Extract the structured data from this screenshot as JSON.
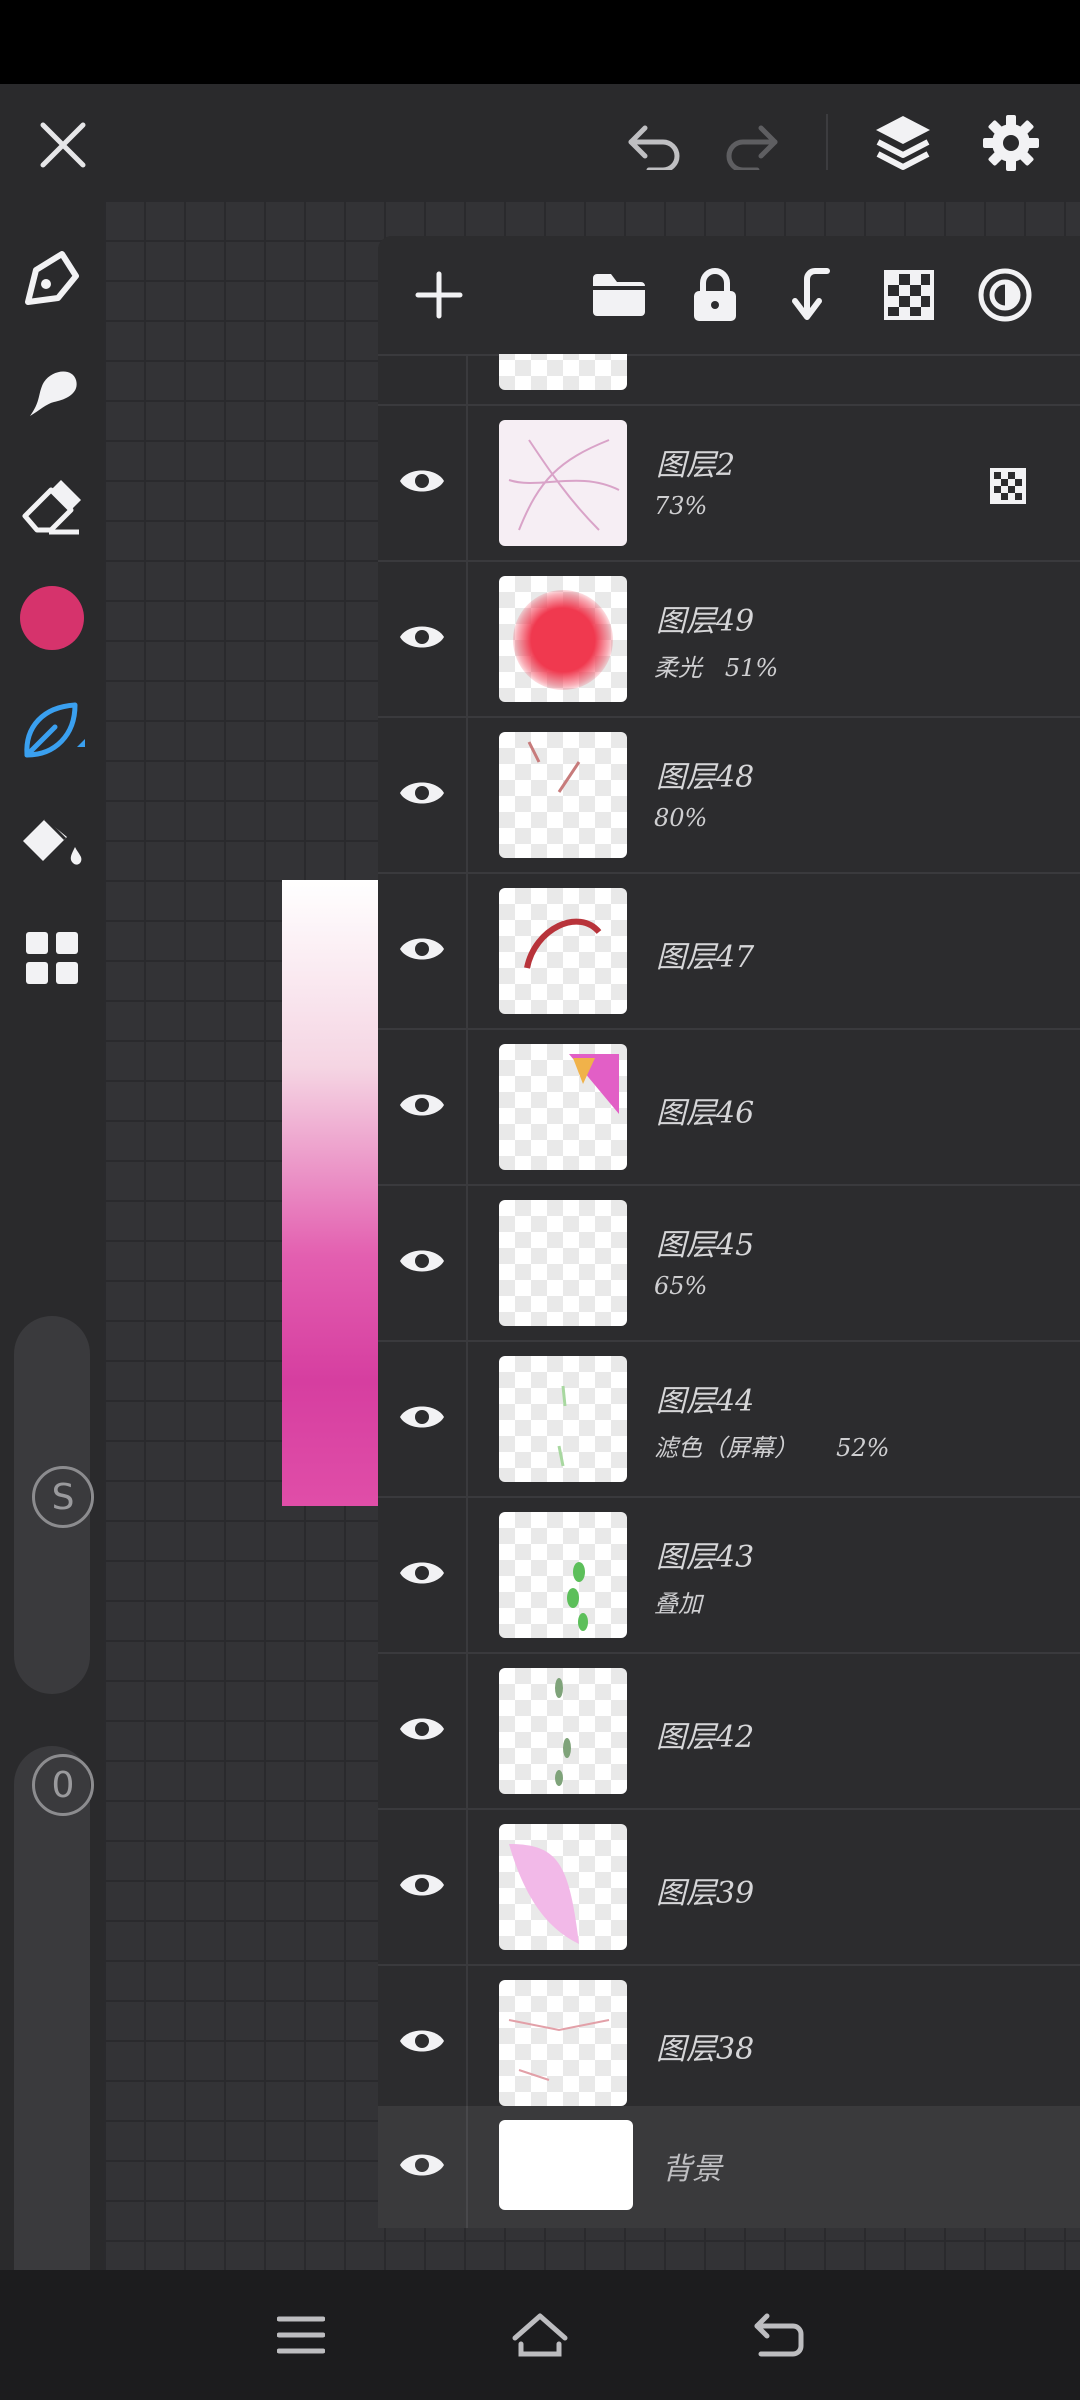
{
  "toolbar": {
    "close": "close",
    "undo": "undo",
    "redo": "redo",
    "layers": "layers",
    "settings": "settings"
  },
  "tools": [
    "pen",
    "smudge",
    "eraser",
    "color",
    "brush",
    "fill",
    "gallery"
  ],
  "current_color": "#d6336c",
  "sliders": {
    "size_label": "S",
    "opacity_label": "0"
  },
  "layer_panel": {
    "actions": [
      "add-layer",
      "folder",
      "lock",
      "merge-down",
      "transparency",
      "blend"
    ],
    "layers": [
      {
        "name": "图层2",
        "meta": "73%",
        "badge": true
      },
      {
        "name": "图层49",
        "meta": "柔光   51%"
      },
      {
        "name": "图层48",
        "meta": "80%"
      },
      {
        "name": "图层47",
        "meta": ""
      },
      {
        "name": "图层46",
        "meta": ""
      },
      {
        "name": "图层45",
        "meta": "65%"
      },
      {
        "name": "图层44",
        "meta": "滤色（屏幕）     52%"
      },
      {
        "name": "图层43",
        "meta": "叠加"
      },
      {
        "name": "图层42",
        "meta": ""
      },
      {
        "name": "图层39",
        "meta": ""
      },
      {
        "name": "图层38",
        "meta": ""
      }
    ],
    "background": {
      "name": "背景"
    }
  }
}
